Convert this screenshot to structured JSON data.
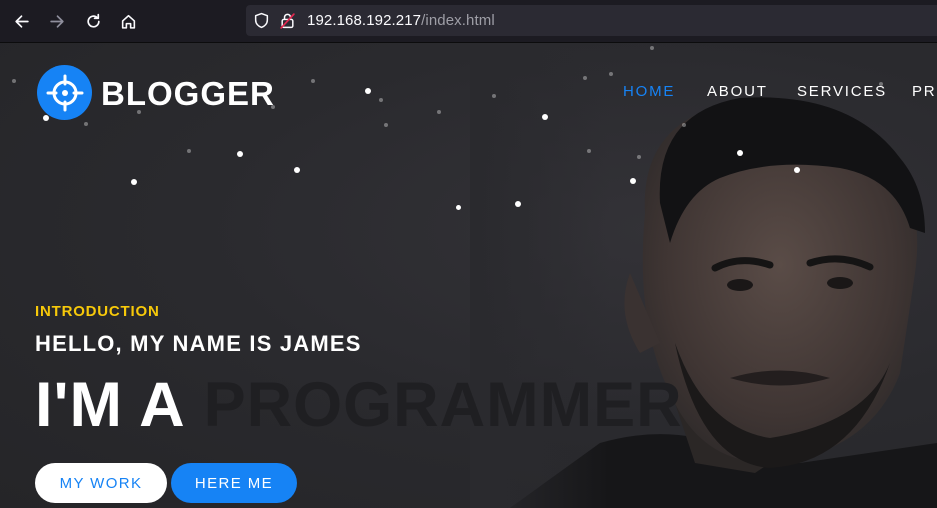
{
  "browser": {
    "url_host": "192.168.192.217",
    "url_path": "/index.html",
    "icons": [
      "back-icon",
      "forward-icon",
      "reload-icon",
      "home-icon",
      "shield-icon",
      "insecure-lock-icon"
    ]
  },
  "site": {
    "logo_text": "BLOGGER",
    "logo_icon": "crosshair-icon",
    "menu": [
      {
        "label": "HOME",
        "active": true
      },
      {
        "label": "ABOUT",
        "active": false
      },
      {
        "label": "SERVICES",
        "active": false
      },
      {
        "label": "PRO",
        "active": false
      }
    ]
  },
  "hero": {
    "intro_label": "INTRODUCTION",
    "hello": "HELLO, MY NAME IS JAMES",
    "headline_prefix": "I'M A",
    "headline_word": "PROGRAMMER",
    "buttons": {
      "my_work": "MY WORK",
      "hire_me": "HERE ME"
    }
  },
  "colors": {
    "accent": "#1683f5",
    "intro": "#f7c90a",
    "background": "#2b2a2f"
  }
}
